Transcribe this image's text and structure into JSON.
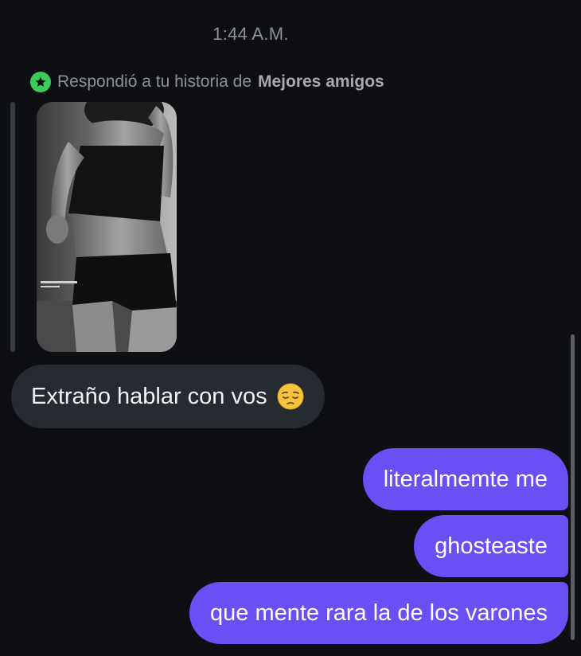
{
  "timestamp": "1:44 A.M.",
  "reply_header": {
    "prefix": "Respondió a tu historia de",
    "audience": "Mejores amigos",
    "badge_icon": "star-icon",
    "badge_color": "#3ccb5a"
  },
  "story": {
    "kind": "photo",
    "caption_text": ""
  },
  "messages": [
    {
      "direction": "received",
      "text": "Extraño hablar con vos",
      "emoji": "pensive-face-icon"
    },
    {
      "direction": "sent",
      "text": "literalmemte me"
    },
    {
      "direction": "sent",
      "text": "ghosteaste"
    },
    {
      "direction": "sent",
      "text": "que mente rara la de los varones"
    }
  ],
  "colors": {
    "background": "#0d0f13",
    "received_bubble": "#262a31",
    "sent_bubble": "#6a4ff5"
  }
}
